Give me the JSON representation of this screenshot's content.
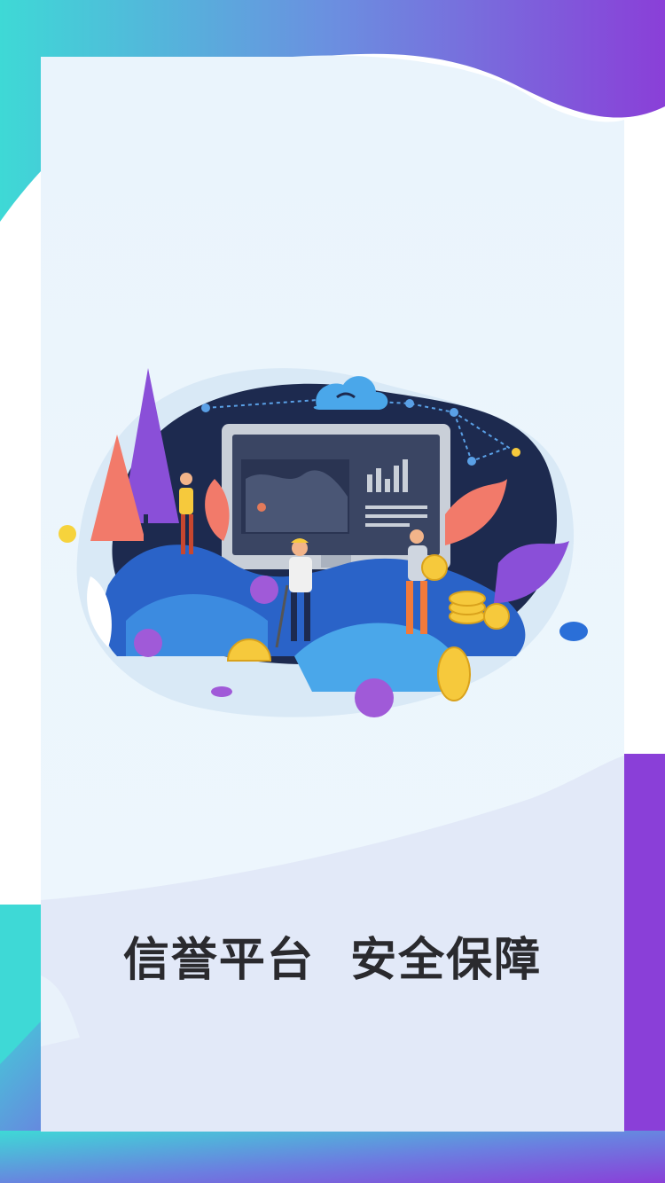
{
  "splash": {
    "slogan": "信誉平台  安全保障"
  },
  "colors": {
    "gradient_teal": "#3ed9d6",
    "gradient_blue": "#5f8ee0",
    "gradient_purple": "#8a3fd8",
    "card_bg": "#eef6fc",
    "card_lower": "#e1e8f8",
    "slogan_text": "#2a2a2e",
    "coin": "#f6c93c"
  },
  "illustration": {
    "icon": "crypto-mining-illustration"
  }
}
